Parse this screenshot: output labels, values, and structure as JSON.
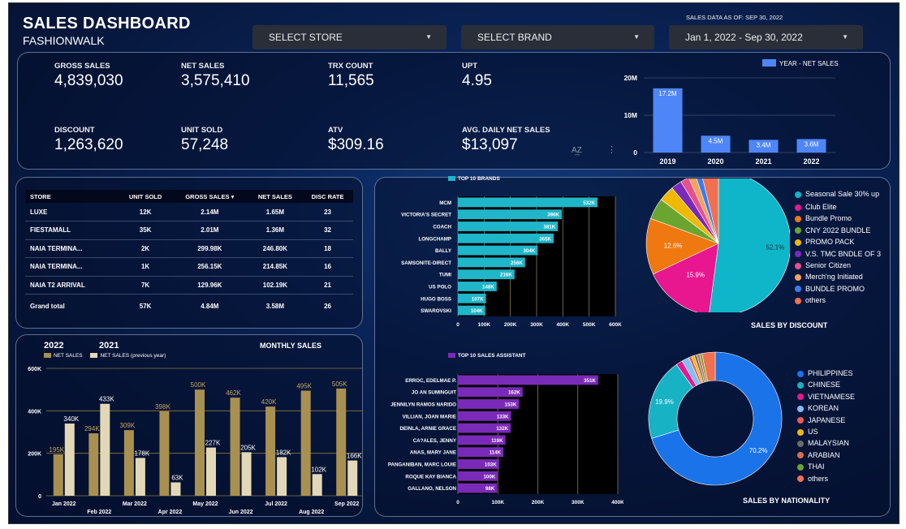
{
  "header": {
    "title": "SALES DASHBOARD",
    "subtitle": "FASHIONWALK",
    "as_of": "SALES DATA AS OF: SEP 30, 2022"
  },
  "filters": {
    "store_label": "SELECT STORE",
    "brand_label": "SELECT BRAND",
    "date_range": "Jan 1, 2022 - Sep 30, 2022"
  },
  "kpis": [
    {
      "label": "GROSS SALES",
      "value": "4,839,030"
    },
    {
      "label": "NET SALES",
      "value": "3,575,410"
    },
    {
      "label": "TRX COUNT",
      "value": "11,565"
    },
    {
      "label": "UPT",
      "value": "4.95"
    },
    {
      "label": "DISCOUNT",
      "value": "1,263,620"
    },
    {
      "label": "UNIT SOLD",
      "value": "57,248"
    },
    {
      "label": "ATV",
      "value": "$309.16"
    },
    {
      "label": "AVG. DAILY NET SALES",
      "value": "$13,097"
    }
  ],
  "toolbar": {
    "sort_icon": "sort-az-icon",
    "more_icon": "more-vertical-icon"
  },
  "store_table": {
    "headers": [
      "STORE",
      "UNIT SOLD",
      "GROSS SALES",
      "NET SALES",
      "DISC RATE"
    ],
    "sort_indicator": "▾",
    "rows": [
      [
        "LUXE",
        "12K",
        "2.14M",
        "1.65M",
        "23"
      ],
      [
        "FIESTAMALL",
        "35K",
        "2.01M",
        "1.36M",
        "32"
      ],
      [
        "NAIA TERMINA...",
        "2K",
        "299.98K",
        "246.80K",
        "18"
      ],
      [
        "NAIA TERMINA...",
        "1K",
        "256.15K",
        "214.85K",
        "16"
      ],
      [
        "NAIA T2 ARRIVAL",
        "7K",
        "129.96K",
        "102.19K",
        "21"
      ]
    ],
    "total": [
      "Grand total",
      "57K",
      "4.84M",
      "3.58M",
      "26"
    ]
  },
  "colors": {
    "year_bar": "#4f86f7",
    "brand_bar": "#1fb6c9",
    "assistant_bar": "#7a2ab8",
    "monthly_2022": "#a89050",
    "monthly_2021": "#e2d8b8",
    "plot_bg": "#000000"
  },
  "chart_data": [
    {
      "type": "bar",
      "legend": "YEAR - NET SALES",
      "categories": [
        "2019",
        "2020",
        "2021",
        "2022"
      ],
      "values": [
        17.2,
        4.5,
        3.4,
        3.6
      ],
      "labels": [
        "17.2M",
        "4.5M",
        "3.4M",
        "3.6M"
      ],
      "yticks": [
        "0",
        "10M",
        "20M"
      ],
      "ylim": [
        0,
        20
      ]
    },
    {
      "type": "bar",
      "title": "TOP 10 BRANDS",
      "categories": [
        "MCM",
        "VICTORIA'S SECRET",
        "COACH",
        "LONGCHAMP",
        "BALLY",
        "SAMSONITE-DIRECT",
        "TUMI",
        "US POLO",
        "HUGO BOSS",
        "SWAROVSKI"
      ],
      "values": [
        532,
        396,
        381,
        365,
        304,
        256,
        216,
        148,
        107,
        104
      ],
      "labels": [
        "532K",
        "396K",
        "381K",
        "365K",
        "304K",
        "256K",
        "216K",
        "148K",
        "107K",
        "104K"
      ],
      "xticks": [
        "0",
        "100K",
        "200K",
        "300K",
        "400K",
        "500K",
        "600K"
      ],
      "xlim": [
        0,
        600
      ]
    },
    {
      "type": "pie",
      "title": "SALES BY DISCOUNT",
      "slices": [
        {
          "name": "Seasonal Sale 30% up",
          "value": 52.1,
          "color": "#0fb5c9"
        },
        {
          "name": "Club Elite",
          "value": 15.9,
          "color": "#e8168f"
        },
        {
          "name": "Bundle Promo",
          "value": 12.6,
          "color": "#f07810"
        },
        {
          "name": "CNY 2022 BUNDLE",
          "value": 4.8,
          "color": "#6aa530"
        },
        {
          "name": "PROMO PACK",
          "value": 3.5,
          "color": "#f0b800"
        },
        {
          "name": "V.S. TMC BNDLE OF 3",
          "value": 2.4,
          "color": "#7a2ab8"
        },
        {
          "name": "Senior Citizen",
          "value": 1.9,
          "color": "#e8508a"
        },
        {
          "name": "Merch'ng Initiated",
          "value": 1.6,
          "color": "#f4a25c"
        },
        {
          "name": "BUNDLE PROMO",
          "value": 1.4,
          "color": "#3a7cf0"
        },
        {
          "name": "others",
          "value": 3.8,
          "color": "#f27050"
        }
      ],
      "labels": [
        "52.1%",
        "15.9%",
        "12.6%"
      ]
    },
    {
      "type": "bar",
      "title": "MONTHLY SALES",
      "series_titles": [
        "2022",
        "2021"
      ],
      "categories": [
        "Jan 2022",
        "Feb 2022",
        "Mar 2022",
        "Apr 2022",
        "May 2022",
        "Jun 2022",
        "Jul 2022",
        "Aug 2022",
        "Sep 2022"
      ],
      "series": [
        {
          "name": "NET SALES",
          "values": [
            195,
            294,
            309,
            398,
            500,
            462,
            420,
            495,
            505
          ],
          "labels": [
            "195K",
            "294K",
            "309K",
            "398K",
            "500K",
            "462K",
            "420K",
            "495K",
            "505K"
          ]
        },
        {
          "name": "NET SALES (previous year)",
          "values": [
            340,
            433,
            178,
            63,
            227,
            205,
            182,
            102,
            166
          ],
          "labels": [
            "340K",
            "433K",
            "178K",
            "63K",
            "227K",
            "205K",
            "182K",
            "102K",
            "166K"
          ]
        }
      ],
      "yticks": [
        "0",
        "200K",
        "400K",
        "600K"
      ],
      "ylim": [
        0,
        600
      ]
    },
    {
      "type": "bar",
      "title": "TOP 10 SALES ASSISTANT",
      "categories": [
        "ERROC, EDELMAE P.",
        "JO AN SUMINGUIT",
        "JENNILYN RAMOS NARIDO",
        "VILLIAN, JOAN MARIE",
        "DEINLA, ARNIE GRACE",
        "CA?ALES, JENNY",
        "ANAS, MARY JANE",
        "PANGANIBAN, MARC LOUIE",
        "ROQUE KAY BIANCA",
        "GALLANO, NELSON"
      ],
      "values": [
        351,
        162,
        153,
        133,
        132,
        119,
        114,
        103,
        100,
        98
      ],
      "labels": [
        "351K",
        "162K",
        "153K",
        "133K",
        "132K",
        "119K",
        "114K",
        "103K",
        "100K",
        "98K"
      ],
      "xticks": [
        "0",
        "100K",
        "200K",
        "300K",
        "400K"
      ],
      "xlim": [
        0,
        400
      ]
    },
    {
      "type": "pie",
      "title": "SALES BY NATIONALITY",
      "slices": [
        {
          "name": "PHILIPPINES",
          "value": 70.2,
          "color": "#1a73e8"
        },
        {
          "name": "CHINESE",
          "value": 19.9,
          "color": "#17b2c4"
        },
        {
          "name": "VIETNAMESE",
          "value": 1.6,
          "color": "#e8168f"
        },
        {
          "name": "KOREAN",
          "value": 1.8,
          "color": "#7ec0f4"
        },
        {
          "name": "JAPANESE",
          "value": 0.7,
          "color": "#f05a5a"
        },
        {
          "name": "US",
          "value": 0.7,
          "color": "#f0b800"
        },
        {
          "name": "MALAYSIAN",
          "value": 0.6,
          "color": "#6b6b6b"
        },
        {
          "name": "ARABIAN",
          "value": 0.7,
          "color": "#d96c50"
        },
        {
          "name": "THAI",
          "value": 0.6,
          "color": "#6aa530"
        },
        {
          "name": "others",
          "value": 3.2,
          "color": "#f27050"
        }
      ],
      "labels": [
        "70.2%",
        "19.9%"
      ]
    }
  ]
}
